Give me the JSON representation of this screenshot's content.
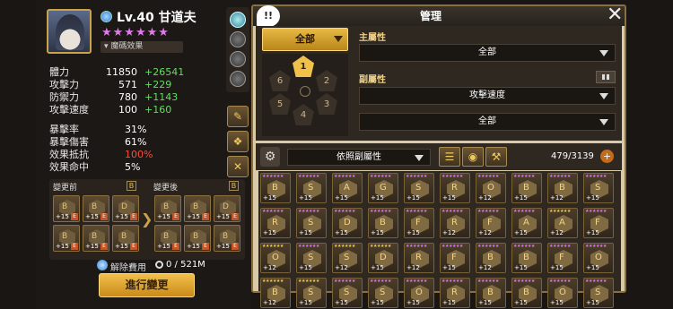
{
  "monster": {
    "level": "Lv.40",
    "name": "甘道夫",
    "stars": "★★★★★★",
    "effect_label": "魔碼效果"
  },
  "stats_main": [
    {
      "label": "體力",
      "value": "11850",
      "bonus": "+26541"
    },
    {
      "label": "攻擊力",
      "value": "571",
      "bonus": "+229"
    },
    {
      "label": "防禦力",
      "value": "780",
      "bonus": "+1143"
    },
    {
      "label": "攻擊速度",
      "value": "100",
      "bonus": "+160"
    }
  ],
  "stats_sub": [
    {
      "label": "暴擊率",
      "value": "31%"
    },
    {
      "label": "暴擊傷害",
      "value": "61%"
    },
    {
      "label": "效果抵抗",
      "value": "100%"
    },
    {
      "label": "效果命中",
      "value": "5%"
    }
  ],
  "rune_change": {
    "before_label": "變更前",
    "after_label": "變更後",
    "badge": "B",
    "before": [
      {
        "glyph": "B",
        "plus": "+15"
      },
      {
        "glyph": "B",
        "plus": "+15"
      },
      {
        "glyph": "D",
        "plus": "+15"
      },
      {
        "glyph": "B",
        "plus": "+15"
      },
      {
        "glyph": "B",
        "plus": "+15"
      },
      {
        "glyph": "B",
        "plus": "+15"
      }
    ],
    "after": [
      {
        "glyph": "B",
        "plus": "+15"
      },
      {
        "glyph": "B",
        "plus": "+15"
      },
      {
        "glyph": "D",
        "plus": "+15"
      },
      {
        "glyph": "B",
        "plus": "+15"
      },
      {
        "glyph": "B",
        "plus": "+15"
      },
      {
        "glyph": "B",
        "plus": "+15"
      }
    ],
    "equip_badge": "E",
    "cost_label": "解除費用",
    "cost_value": "0 / 521M",
    "confirm_button": "進行變更"
  },
  "manage": {
    "title": "管理",
    "help": "!!",
    "close": "✕",
    "all_button": "全部",
    "slots": [
      "1",
      "2",
      "3",
      "4",
      "5",
      "6"
    ],
    "main_attr_label": "主屬性",
    "main_attr_value": "全部",
    "sub_attr_label": "副屬性",
    "sub_attr_value_1": "攻擊速度",
    "sub_attr_value_2": "全部"
  },
  "toolbar": {
    "sort_label": "依照副屬性",
    "count": "479/3139",
    "plus": "+"
  },
  "rune_grid": [
    {
      "g": "B",
      "p": "+15",
      "purple": true
    },
    {
      "g": "S",
      "p": "+15",
      "purple": true
    },
    {
      "g": "A",
      "p": "+15",
      "purple": true
    },
    {
      "g": "G",
      "p": "+15",
      "purple": true
    },
    {
      "g": "S",
      "p": "+15",
      "purple": true
    },
    {
      "g": "R",
      "p": "+15",
      "purple": true
    },
    {
      "g": "O",
      "p": "+12",
      "purple": true
    },
    {
      "g": "B",
      "p": "+15",
      "purple": true
    },
    {
      "g": "B",
      "p": "+12",
      "purple": true
    },
    {
      "g": "S",
      "p": "+15",
      "purple": true
    },
    {
      "g": "R",
      "p": "+15",
      "purple": true
    },
    {
      "g": "S",
      "p": "+15",
      "purple": true
    },
    {
      "g": "D",
      "p": "+15",
      "purple": true
    },
    {
      "g": "B",
      "p": "+15",
      "purple": true
    },
    {
      "g": "F",
      "p": "+15",
      "purple": true
    },
    {
      "g": "R",
      "p": "+12",
      "purple": true
    },
    {
      "g": "F",
      "p": "+12",
      "purple": true
    },
    {
      "g": "A",
      "p": "+15",
      "purple": true
    },
    {
      "g": "A",
      "p": "+12",
      "purple": false
    },
    {
      "g": "F",
      "p": "+15",
      "purple": true
    },
    {
      "g": "O",
      "p": "+12",
      "purple": false
    },
    {
      "g": "S",
      "p": "+15",
      "purple": true
    },
    {
      "g": "S",
      "p": "+12",
      "purple": false
    },
    {
      "g": "D",
      "p": "+15",
      "purple": false
    },
    {
      "g": "R",
      "p": "+12",
      "purple": true
    },
    {
      "g": "F",
      "p": "+15",
      "purple": true
    },
    {
      "g": "B",
      "p": "+12",
      "purple": true
    },
    {
      "g": "B",
      "p": "+15",
      "purple": true
    },
    {
      "g": "F",
      "p": "+15",
      "purple": true
    },
    {
      "g": "O",
      "p": "+15",
      "purple": true
    },
    {
      "g": "B",
      "p": "+12",
      "purple": false
    },
    {
      "g": "S",
      "p": "+15",
      "purple": false
    },
    {
      "g": "S",
      "p": "+15",
      "purple": true
    },
    {
      "g": "S",
      "p": "+15",
      "purple": true
    },
    {
      "g": "O",
      "p": "+15",
      "purple": true
    },
    {
      "g": "R",
      "p": "+15",
      "purple": true
    },
    {
      "g": "B",
      "p": "+15",
      "purple": true
    },
    {
      "g": "B",
      "p": "+15",
      "purple": true
    },
    {
      "g": "O",
      "p": "+15",
      "purple": true
    },
    {
      "g": "S",
      "p": "+15",
      "purple": true
    }
  ],
  "colors": {
    "accent": "#f0c24a",
    "bonus_green": "#5fe05f",
    "highlight_red": "#ff4a3d",
    "stars_purple": "#e07ae8"
  }
}
